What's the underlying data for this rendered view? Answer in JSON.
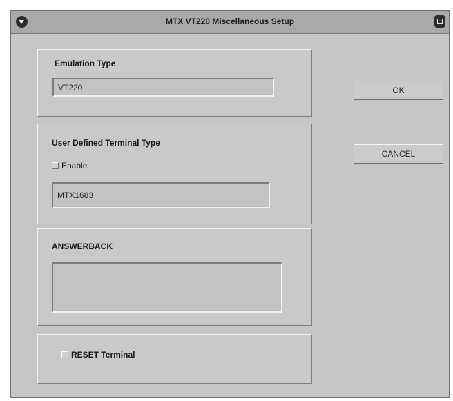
{
  "window": {
    "title": "MTX VT220 Miscellaneous Setup"
  },
  "emulation": {
    "heading": "Emulation Type",
    "value": "VT220"
  },
  "user_defined": {
    "heading": "User Defined Terminal Type",
    "enable_label": "Enable",
    "enabled": false,
    "value": "MTX1683"
  },
  "answerback": {
    "heading": "ANSWERBACK",
    "value": ""
  },
  "reset": {
    "label": "RESET Terminal",
    "checked": false
  },
  "buttons": {
    "ok": "OK",
    "cancel": "CANCEL"
  }
}
